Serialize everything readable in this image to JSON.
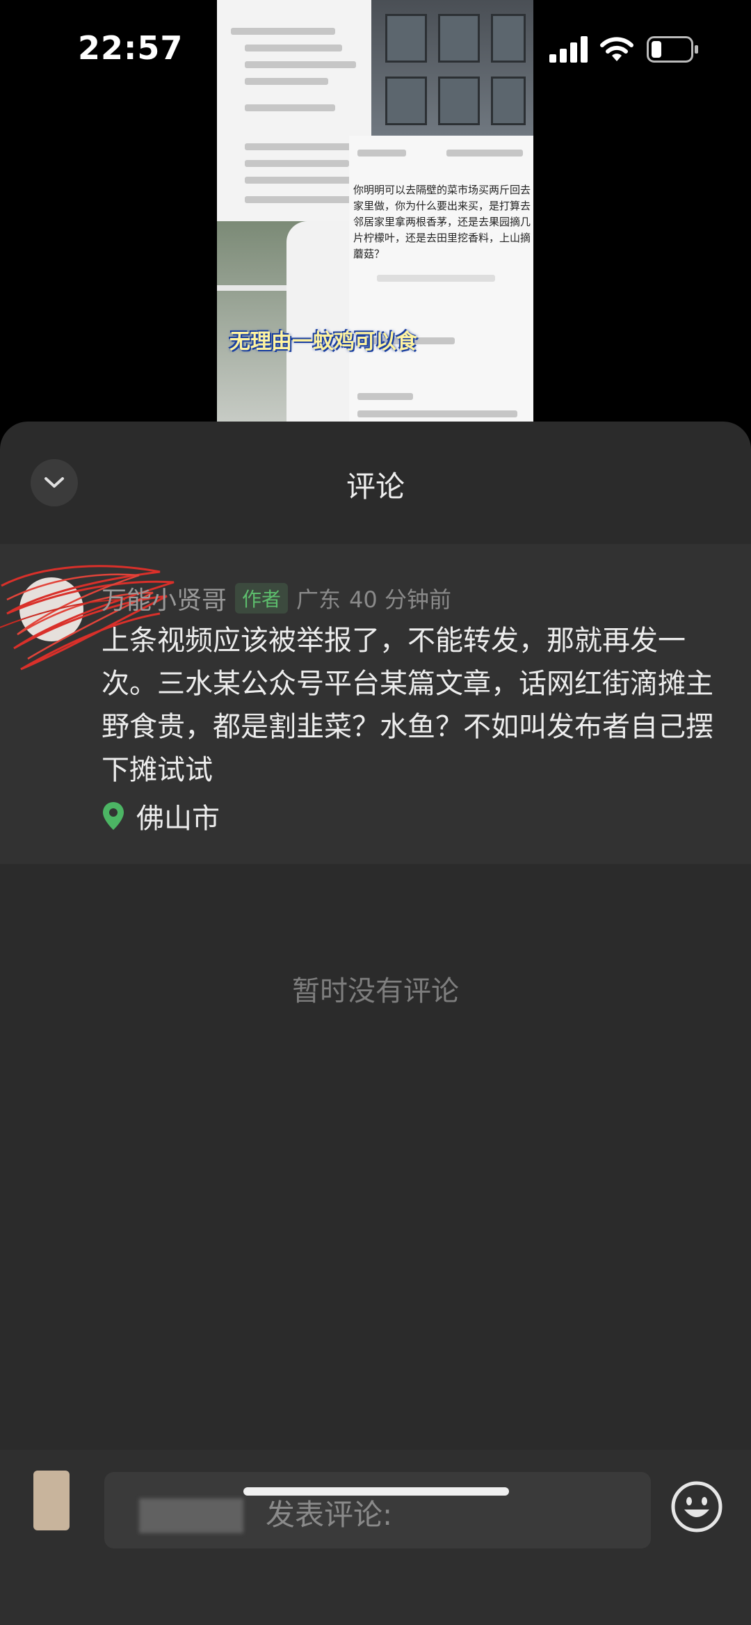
{
  "status_bar": {
    "time": "22:57"
  },
  "video_preview": {
    "caption": "无理由一蚊鸡可以食",
    "comment_text": "你明明可以去隔壁的菜市场买两斤回去家里做，你为什么要出来买，是打算去邻居家里拿两根香茅，还是去果园摘几片柠檬叶，还是去田里挖香料，上山摘蘑菇？"
  },
  "sheet": {
    "title": "评论"
  },
  "comment": {
    "author": "万能小贤哥",
    "badge": "作者",
    "region": "广东",
    "time": "40 分钟前",
    "text": "上条视频应该被举报了，不能转发，那就再发一次。三水某公众号平台某篇文章，话网红街滴摊主野食贵，都是割韭菜？水鱼？不如叫发布者自己摆下摊试试",
    "location": "佛山市"
  },
  "empty_state": "暂时没有评论",
  "input": {
    "placeholder": "发表评论:"
  },
  "colors": {
    "sheet_background": "#2b2b2b",
    "badge_green": "#5dbe6d",
    "location_pin": "#4cb564"
  },
  "icons": {
    "collapse": "chevron-down-icon",
    "location": "location-pin-icon",
    "emoji": "smiley-icon"
  }
}
